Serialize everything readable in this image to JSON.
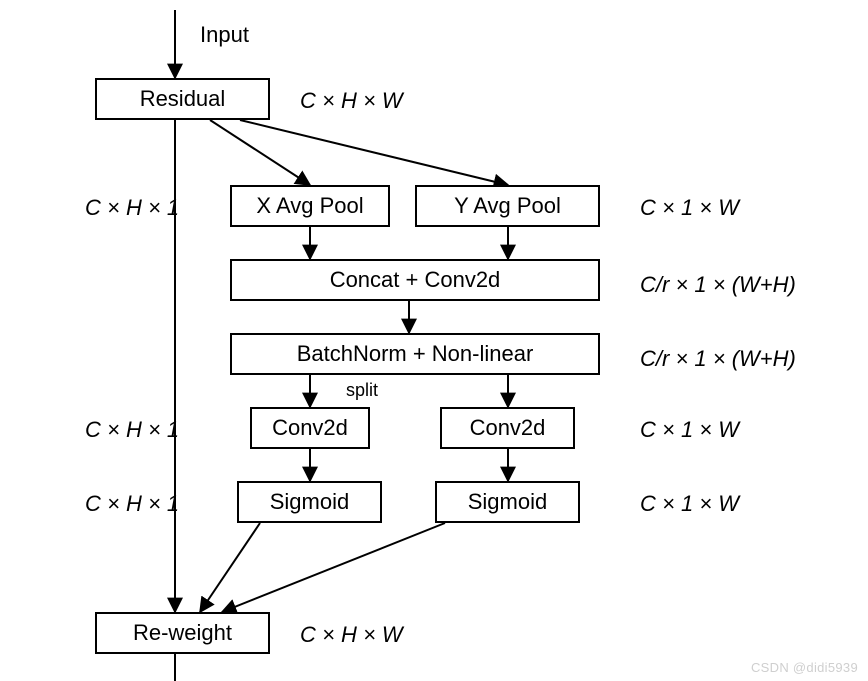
{
  "labels": {
    "input": "Input",
    "residual": "Residual",
    "x_avg_pool": "X Avg Pool",
    "y_avg_pool": "Y Avg Pool",
    "concat": "Concat + Conv2d",
    "bn": "BatchNorm + Non-linear",
    "split": "split",
    "conv_a": "Conv2d",
    "conv_b": "Conv2d",
    "sigm_a": "Sigmoid",
    "sigm_b": "Sigmoid",
    "reweight": "Re-weight"
  },
  "dims": {
    "residual": "C × H × W",
    "xpool": "C × H × 1",
    "ypool": "C × 1 × W",
    "concat": "C/r × 1 × (W+H)",
    "bn": "C/r × 1 × (W+H)",
    "conv_a": "C × H × 1",
    "conv_b": "C × 1 × W",
    "sigm_a": "C × H × 1",
    "sigm_b": "C × 1 × W",
    "reweight": "C × H × W"
  },
  "watermark": "CSDN @didi5939"
}
